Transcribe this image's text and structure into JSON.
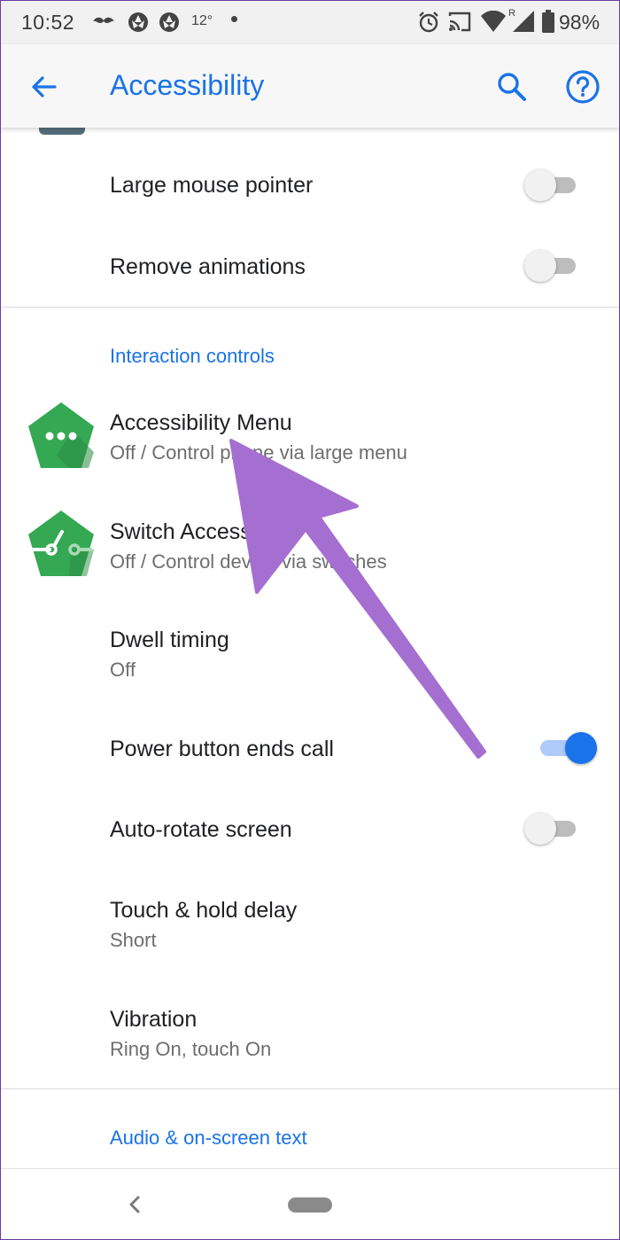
{
  "status_bar": {
    "time": "10:52",
    "temperature": "12°",
    "battery": "98%"
  },
  "app_bar": {
    "title": "Accessibility"
  },
  "items": {
    "large_mouse_pointer": {
      "title": "Large mouse pointer",
      "enabled": false
    },
    "remove_animations": {
      "title": "Remove animations",
      "enabled": false
    },
    "interaction_header": "Interaction controls",
    "accessibility_menu": {
      "title": "Accessibility Menu",
      "subtitle": "Off / Control phone via large menu"
    },
    "switch_access": {
      "title": "Switch Access",
      "subtitle": "Off / Control device via switches"
    },
    "dwell_timing": {
      "title": "Dwell timing",
      "subtitle": "Off"
    },
    "power_button": {
      "title": "Power button ends call",
      "enabled": true
    },
    "auto_rotate": {
      "title": "Auto-rotate screen",
      "enabled": false
    },
    "touch_hold": {
      "title": "Touch & hold delay",
      "subtitle": "Short"
    },
    "vibration": {
      "title": "Vibration",
      "subtitle": "Ring On, touch On"
    },
    "audio_header": "Audio & on-screen text"
  },
  "colors": {
    "accent": "#1a73e8",
    "icon_green": "#34a853",
    "annotation_arrow": "#a56fd1"
  },
  "icons": [
    "back-arrow-icon",
    "search-icon",
    "help-icon",
    "accessibility-menu-icon",
    "switch-access-icon",
    "nav-back-icon"
  ]
}
